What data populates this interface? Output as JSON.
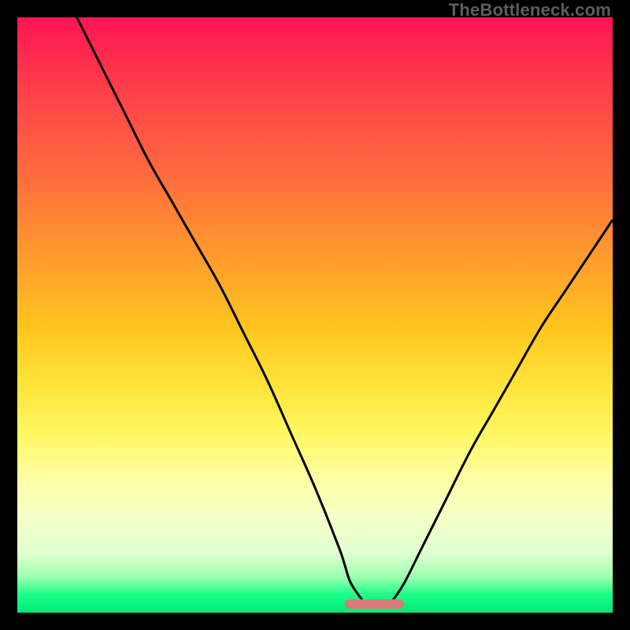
{
  "watermark": "TheBottleneck.com",
  "chart_data": {
    "type": "line",
    "title": "",
    "xlabel": "",
    "ylabel": "",
    "xlim": [
      0,
      100
    ],
    "ylim": [
      0,
      100
    ],
    "grid": false,
    "legend": false,
    "background_gradient_top_color": "#ff1454",
    "background_gradient_bottom_color": "#00e87a",
    "optimal_range_x": [
      55,
      65
    ],
    "optimal_y": 1.5,
    "series": [
      {
        "name": "left",
        "x": [
          10,
          14,
          18,
          22,
          26,
          30,
          34,
          38,
          42,
          46,
          50,
          54,
          55,
          56,
          58
        ],
        "y": [
          100,
          92,
          84,
          76,
          69,
          62,
          55,
          47,
          39,
          30,
          21,
          11,
          8,
          5,
          2
        ]
      },
      {
        "name": "right",
        "x": [
          63,
          65,
          68,
          72,
          76,
          80,
          84,
          88,
          92,
          96,
          100
        ],
        "y": [
          2,
          5,
          11,
          19,
          27,
          34,
          41,
          48,
          54,
          60,
          66
        ]
      }
    ]
  }
}
